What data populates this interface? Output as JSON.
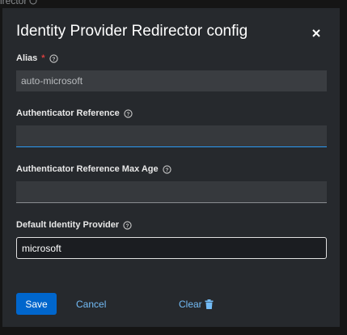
{
  "backdrop": {
    "partial_text": "irector"
  },
  "dialog": {
    "title": "Identity Provider Redirector config",
    "close_icon": "close-icon"
  },
  "fields": {
    "alias": {
      "label": "Alias",
      "required_mark": "*",
      "value": "auto-microsoft"
    },
    "authenticator_reference": {
      "label": "Authenticator Reference",
      "value": ""
    },
    "authenticator_reference_max_age": {
      "label": "Authenticator Reference Max Age",
      "value": ""
    },
    "default_identity_provider": {
      "label": "Default Identity Provider",
      "value": "microsoft"
    }
  },
  "actions": {
    "save_label": "Save",
    "cancel_label": "Cancel",
    "clear_label": "Clear",
    "clear_icon": "trash-icon"
  },
  "colors": {
    "primary": "#0066cc",
    "link": "#73bcf7",
    "required": "#d93f3f",
    "focus_underline": "#2b9af3"
  }
}
